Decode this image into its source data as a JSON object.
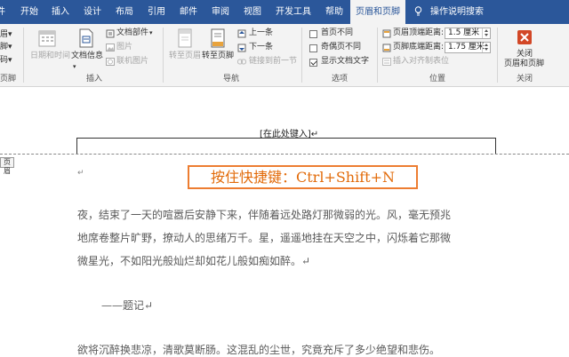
{
  "tabs": [
    {
      "label": "开始",
      "active": false
    },
    {
      "label": "插入",
      "active": false
    },
    {
      "label": "设计",
      "active": false
    },
    {
      "label": "布局",
      "active": false
    },
    {
      "label": "引用",
      "active": false
    },
    {
      "label": "邮件",
      "active": false
    },
    {
      "label": "审阅",
      "active": false
    },
    {
      "label": "视图",
      "active": false
    },
    {
      "label": "开发工具",
      "active": false
    },
    {
      "label": "帮助",
      "active": false
    },
    {
      "label": "页眉和页脚",
      "active": true
    }
  ],
  "tell_me": "操作说明搜索",
  "ribbon": {
    "left_cut": [
      "眉▾",
      "脚▾",
      "码▾",
      "页脚"
    ],
    "insert": {
      "date_time": "日期和时间",
      "doc_info": "文档信息",
      "doc_parts": "文档部件",
      "picture": "图片",
      "online_picture": "联机图片",
      "label": "插入"
    },
    "nav": {
      "goto_header": "转至页眉",
      "goto_footer": "转至页脚",
      "previous": "上一条",
      "next": "下一条",
      "link_previous": "链接到前一节",
      "label": "导航"
    },
    "options": {
      "diff_first": "首页不同",
      "diff_odd_even": "奇偶页不同",
      "show_doc_text": "显示文档文字",
      "show_doc_text_checked": true,
      "label": "选项"
    },
    "position": {
      "header_top": "页眉顶端距离:",
      "header_top_value": "1.5 厘米",
      "footer_bottom": "页脚底端距离:",
      "footer_bottom_value": "1.75 厘米",
      "insert_align_tab": "插入对齐制表位",
      "label": "位置"
    },
    "close": {
      "button": "关闭",
      "button_line2": "页眉和页脚",
      "label": "关闭"
    }
  },
  "document": {
    "header_field": "[在此处键入]↵",
    "header_tag": "页眉",
    "para_mark": "↵",
    "shortcut": "按住快捷键：Ctrl+Shift+N",
    "body_lines": [
      "夜，结束了一天的喧嚣后安静下来，伴随着远处路灯那微弱的光。风，毫无预兆",
      "地席卷整片旷野，撩动人的思绪万千。星，遥遥地挂在天空之中，闪烁着它那微",
      "微星光，不如阳光般灿烂却如花儿般如痴如醉。↵"
    ],
    "attribution": "——题记↵",
    "body_line_last": "欲将沉醉换悲凉，清歌莫断肠。这混乱的尘世，究竟充斥了多少绝望和悲伤。"
  },
  "colors": {
    "tab_bar": "#2b579a",
    "ribbon_bg": "#f3f3f3",
    "highlight_border": "#ed7d31",
    "highlight_text": "#e26b0a",
    "close_red": "#d24726"
  }
}
